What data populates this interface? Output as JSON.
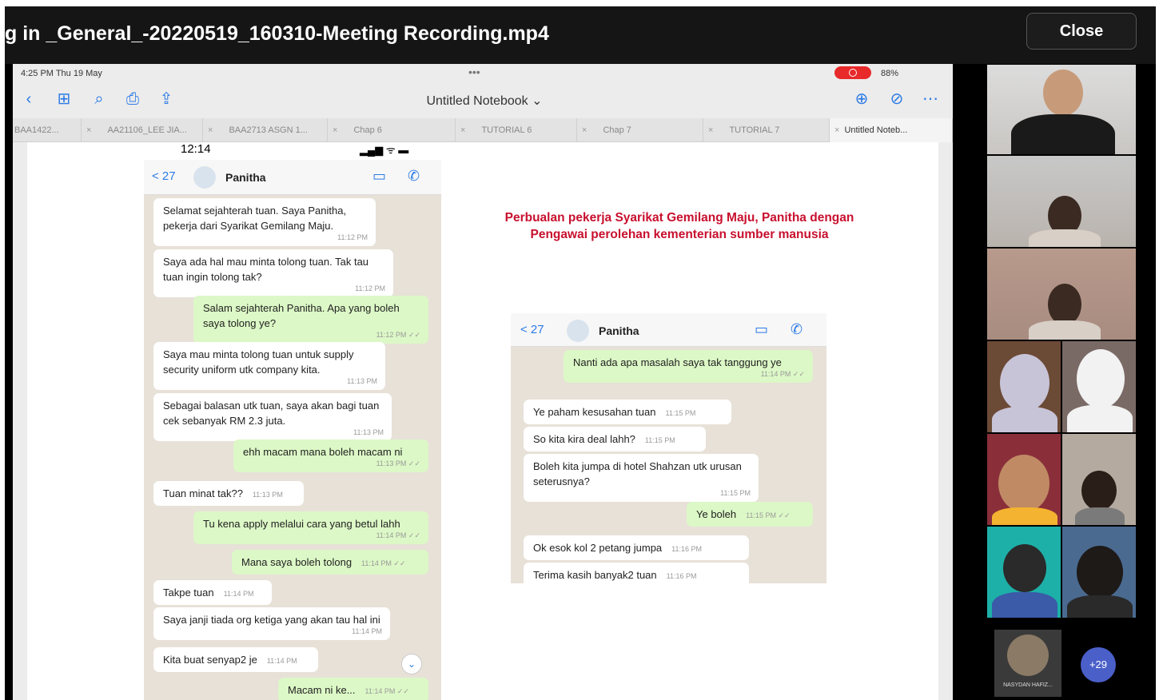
{
  "window": {
    "title": "g in _General_-20220519_160310-Meeting Recording.mp4",
    "close_label": "Close"
  },
  "ipad": {
    "status_time": "4:25 PM   Thu 19 May",
    "status_dots": "•••",
    "battery": "88%",
    "notebook_title": "Untitled Notebook ⌄",
    "tabs": [
      {
        "label": "BAA1422..."
      },
      {
        "label": "AA21106_LEE JIA..."
      },
      {
        "label": "BAA2713 ASGN 1..."
      },
      {
        "label": "Chap 6"
      },
      {
        "label": "TUTORIAL 6"
      },
      {
        "label": "Chap 7"
      },
      {
        "label": "TUTORIAL 7"
      },
      {
        "label": "Untitled Noteb..."
      }
    ]
  },
  "phone": {
    "status_time": "12:14",
    "status_signal": "▂▄▆ ᯤ ▬",
    "back": "< 27",
    "contact": "Panitha",
    "messages": [
      {
        "dir": "in",
        "text": "Selamat sejahterah tuan. Saya Panitha, pekerja dari Syarikat Gemilang Maju.",
        "time": "11:12 PM"
      },
      {
        "dir": "in",
        "text": "Saya ada hal mau minta tolong tuan. Tak tau tuan ingin tolong tak?",
        "time": "11:12 PM"
      },
      {
        "dir": "out",
        "text": "Salam sejahterah Panitha. Apa yang boleh saya tolong ye?",
        "time": "11:12 PM ✓✓"
      },
      {
        "dir": "in",
        "text": "Saya mau minta tolong tuan untuk supply security uniform utk company kita.",
        "time": "11:13 PM"
      },
      {
        "dir": "in",
        "text": "Sebagai balasan utk tuan, saya akan bagi tuan cek sebanyak RM 2.3 juta.",
        "time": "11:13 PM"
      },
      {
        "dir": "out",
        "text": "ehh macam mana boleh macam ni",
        "time": "11:13 PM ✓✓"
      },
      {
        "dir": "in",
        "text": "Tuan minat tak??",
        "time": "11:13 PM"
      },
      {
        "dir": "out",
        "text": "Tu kena apply melalui cara yang betul lahh",
        "time": "11:14 PM ✓✓"
      },
      {
        "dir": "out",
        "text": "Mana saya boleh tolong",
        "time": "11:14 PM ✓✓"
      },
      {
        "dir": "in",
        "text": "Takpe tuan",
        "time": "11:14 PM"
      },
      {
        "dir": "in",
        "text": "Saya janji tiada org ketiga yang akan tau hal ini",
        "time": "11:14 PM"
      },
      {
        "dir": "in",
        "text": "Kita buat senyap2 je",
        "time": "11:14 PM"
      },
      {
        "dir": "out",
        "text": "Macam ni ke...",
        "time": "11:14 PM ✓✓"
      }
    ]
  },
  "caption": "Perbualan pekerja Syarikat Gemilang Maju, Panitha dengan Pengawai perolehan kementerian sumber manusia",
  "screenshot2": {
    "back": "< 27",
    "contact": "Panitha",
    "messages": [
      {
        "dir": "out",
        "text": "Nanti ada apa masalah saya tak tanggung ye",
        "time": "11:14 PM ✓✓"
      },
      {
        "dir": "in",
        "text": "Ye paham kesusahan tuan",
        "time": "11:15 PM"
      },
      {
        "dir": "in",
        "text": "So kita kira deal lahh?",
        "time": "11:15 PM"
      },
      {
        "dir": "in",
        "text": "Boleh kita jumpa di hotel Shahzan utk urusan seterusnya?",
        "time": "11:15 PM"
      },
      {
        "dir": "out",
        "text": "Ye boleh",
        "time": "11:15 PM ✓✓"
      },
      {
        "dir": "in",
        "text": "Ok esok kol 2 petang jumpa",
        "time": "11:16 PM"
      },
      {
        "dir": "in",
        "text": "Terima kasih banyak2 tuan",
        "time": "11:16 PM"
      }
    ]
  },
  "participants": {
    "more_label": "NASYDAN HAFIZ...",
    "more_count": "+29"
  }
}
